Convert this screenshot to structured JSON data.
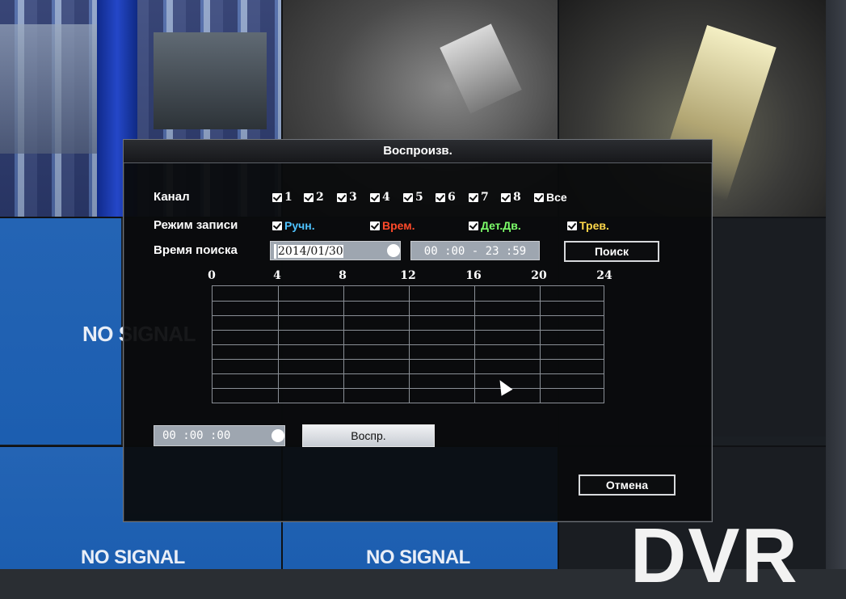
{
  "background": {
    "no_signal_label": "NO SIGNAL",
    "dvr_label": "DVR"
  },
  "dialog": {
    "title": "Воспроизв.",
    "channel": {
      "label": "Канал",
      "items": [
        "1",
        "2",
        "3",
        "4",
        "5",
        "6",
        "7",
        "8",
        "Все"
      ]
    },
    "record_mode": {
      "label": "Режим записи",
      "items": [
        {
          "label": "Ручн.",
          "color": "#4fc3ff"
        },
        {
          "label": "Врем.",
          "color": "#ff4a2a"
        },
        {
          "label": "Дет.Дв.",
          "color": "#7dff6a"
        },
        {
          "label": "Трев.",
          "color": "#ffd84a"
        }
      ]
    },
    "search_time": {
      "label": "Время поиска",
      "date_value": "2014/01/30",
      "time_range": "00 :00 - 23 :59",
      "search_button": "Поиск"
    },
    "timeline": {
      "hour_ticks": [
        "0",
        "4",
        "8",
        "12",
        "16",
        "20",
        "24"
      ],
      "rows": 8
    },
    "playback": {
      "time_value": "00 :00 :00",
      "play_button": "Воспр."
    },
    "cancel_button": "Отмена"
  }
}
